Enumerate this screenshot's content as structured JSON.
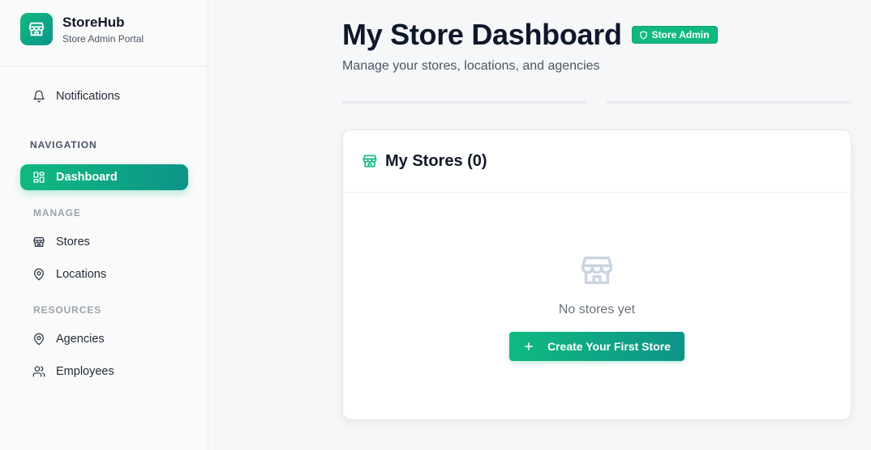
{
  "brand": {
    "name": "StoreHub",
    "subtitle": "Store Admin Portal",
    "icon": "store-icon"
  },
  "sidebar": {
    "notifications": {
      "label": "Notifications",
      "icon": "bell-icon"
    },
    "sections": {
      "navigation": "NAVIGATION",
      "manage": "MANAGE",
      "resources": "RESOURCES"
    },
    "items": [
      {
        "label": "Dashboard",
        "icon": "dashboard-icon",
        "active": true
      },
      {
        "label": "Stores",
        "icon": "store-icon"
      },
      {
        "label": "Locations",
        "icon": "map-pin-icon"
      },
      {
        "label": "Agencies",
        "icon": "map-pin-icon"
      },
      {
        "label": "Employees",
        "icon": "users-icon"
      }
    ]
  },
  "header": {
    "title": "My Store Dashboard",
    "badge": "Store Admin",
    "badge_icon": "shield-icon",
    "subtitle": "Manage your stores, locations, and agencies"
  },
  "stores_card": {
    "title": "My Stores (0)",
    "icon": "store-icon",
    "empty_text": "No stores yet",
    "empty_icon": "store-icon",
    "create_button": "Create Your First Store",
    "create_icon": "plus-icon"
  },
  "colors": {
    "accent": "#10b981",
    "accent_dark": "#0d9488"
  }
}
